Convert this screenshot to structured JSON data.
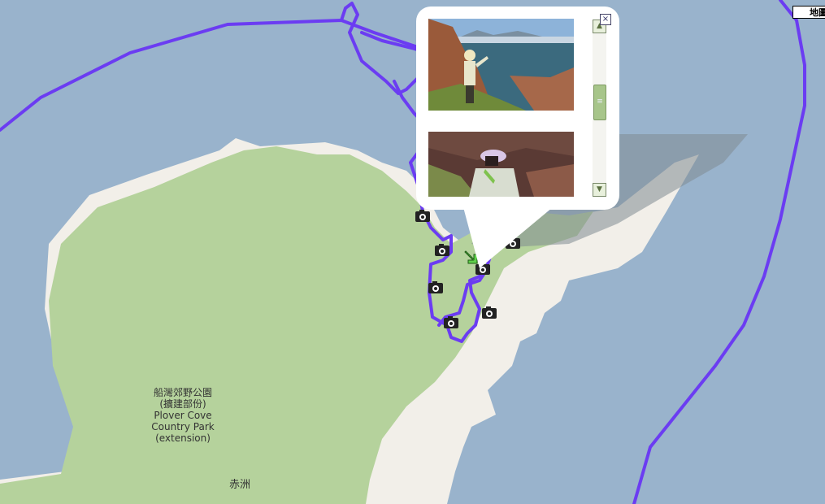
{
  "map": {
    "colors": {
      "water": "#99b3cc",
      "land": "#f2efe9",
      "park": "#b5d29c",
      "track": "#6b3cf2"
    },
    "labels": {
      "park_chinese_1": "船灣郊野公園",
      "park_chinese_2": "(擴建部份)",
      "park_english_1": "Plover Cove",
      "park_english_2": "Country Park",
      "park_english_3": "(extension)",
      "place": "赤洲"
    },
    "maptype_button": "地圖",
    "markers_icon": "camera-icon",
    "arrow_icon": "arrow-down-right-icon"
  },
  "popup": {
    "close_label": "×",
    "scroll_up": "▲",
    "scroll_down": "▼",
    "scroll_thumb": "≡",
    "thumb_position": 0.45
  }
}
